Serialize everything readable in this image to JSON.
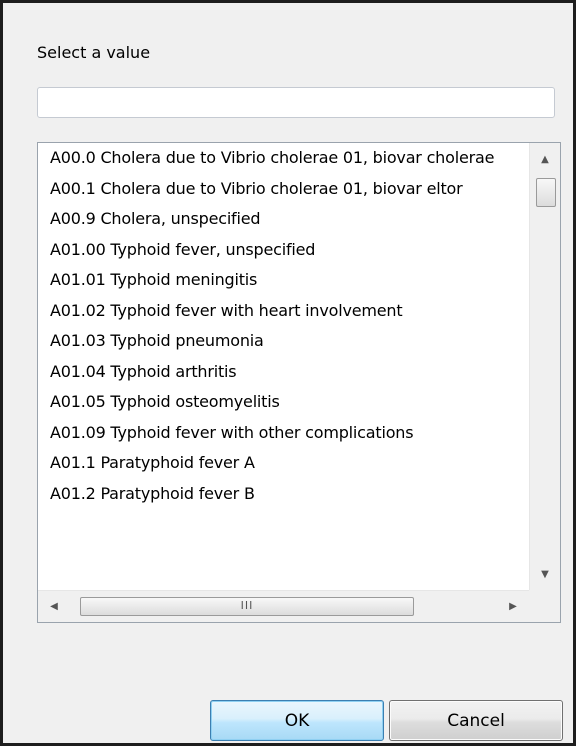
{
  "dialog": {
    "prompt": "Select a value",
    "search": {
      "value": "",
      "placeholder": ""
    }
  },
  "list": {
    "items": [
      "A00.0 Cholera due to Vibrio cholerae 01, biovar cholerae",
      "A00.1 Cholera due to Vibrio cholerae 01, biovar eltor",
      "A00.9 Cholera, unspecified",
      "A01.00 Typhoid fever, unspecified",
      "A01.01 Typhoid meningitis",
      "A01.02 Typhoid fever with heart involvement",
      "A01.03 Typhoid pneumonia",
      "A01.04 Typhoid arthritis",
      "A01.05 Typhoid osteomyelitis",
      "A01.09 Typhoid fever with other complications",
      "A01.1 Paratyphoid fever A",
      "A01.2 Paratyphoid fever B"
    ],
    "hscroll_thumb_glyph": "III"
  },
  "buttons": {
    "ok": "OK",
    "cancel": "Cancel"
  },
  "icons": {
    "scroll_up": "scroll-up-arrow-icon",
    "scroll_down": "scroll-down-arrow-icon",
    "scroll_left": "scroll-left-arrow-icon",
    "scroll_right": "scroll-right-arrow-icon"
  }
}
